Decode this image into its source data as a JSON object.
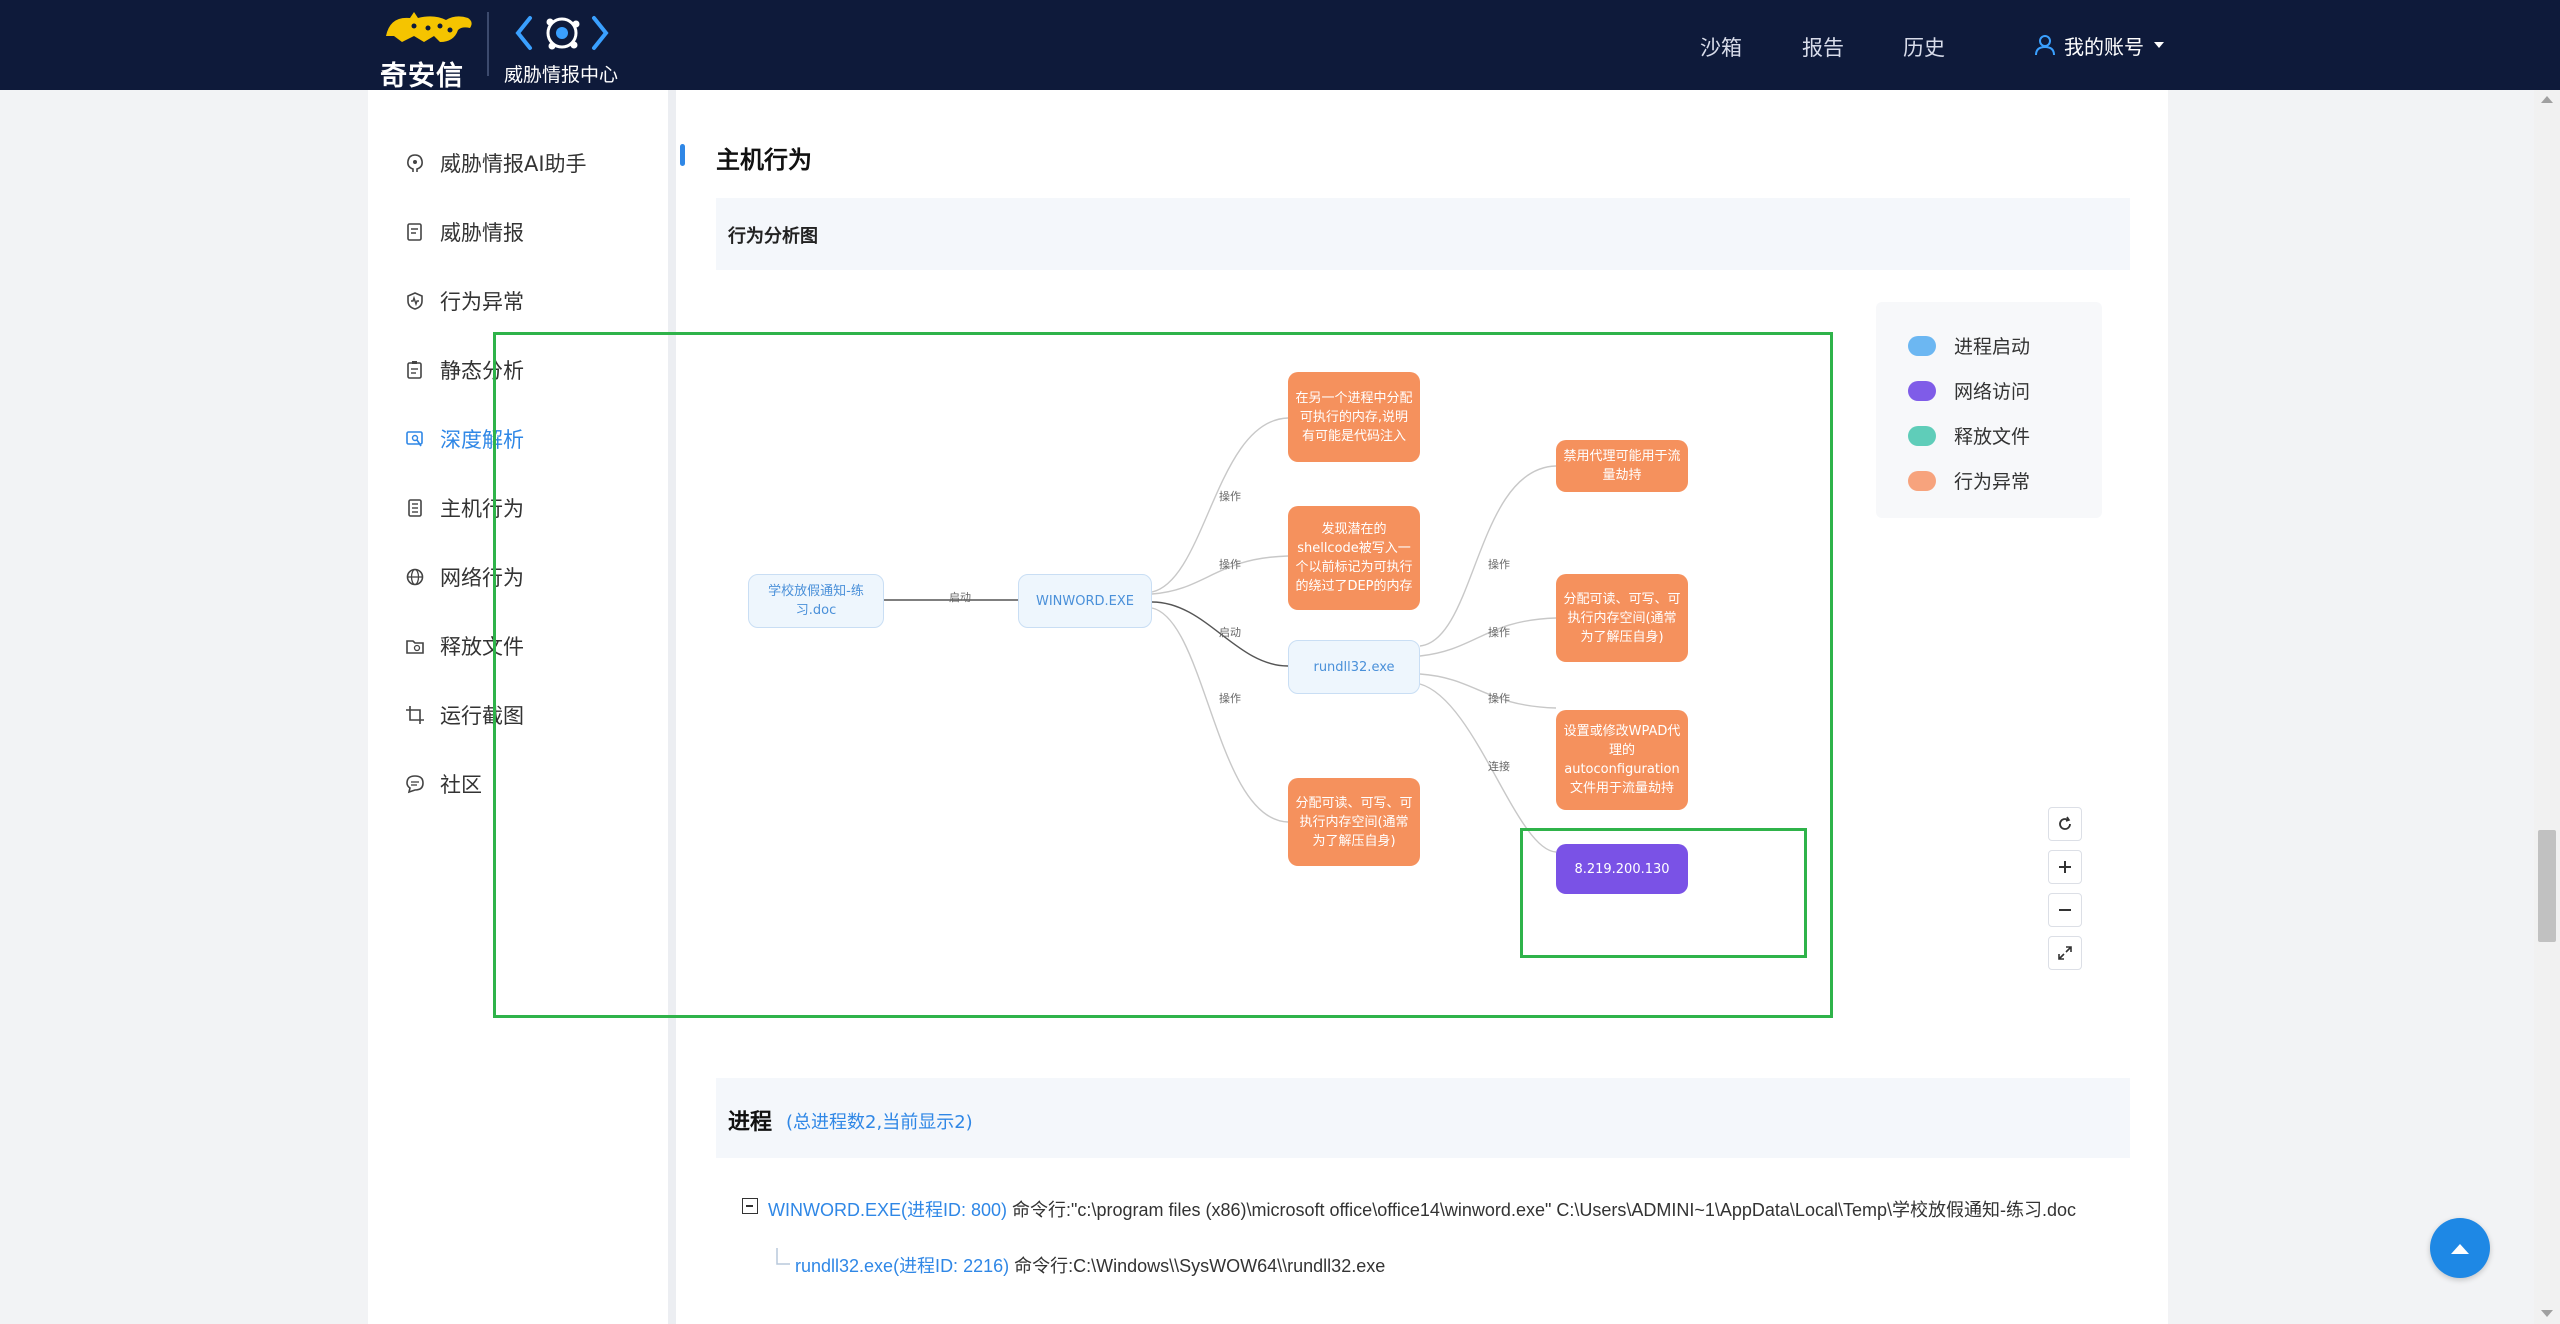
{
  "header": {
    "logo_text": "奇安信",
    "product_name": "威胁情报中心",
    "nav": [
      {
        "label": "沙箱"
      },
      {
        "label": "报告"
      },
      {
        "label": "历史"
      }
    ],
    "account_label": "我的账号"
  },
  "sidebar": {
    "items": [
      {
        "label": "威胁情报AI助手",
        "icon": "ai-brain-icon"
      },
      {
        "label": "威胁情报",
        "icon": "report-icon"
      },
      {
        "label": "行为异常",
        "icon": "shield-pulse-icon"
      },
      {
        "label": "静态分析",
        "icon": "clipboard-icon"
      },
      {
        "label": "深度解析",
        "icon": "deep-analysis-icon",
        "active": true
      },
      {
        "label": "主机行为",
        "icon": "host-icon"
      },
      {
        "label": "网络行为",
        "icon": "network-globe-icon"
      },
      {
        "label": "释放文件",
        "icon": "folder-icon"
      },
      {
        "label": "运行截图",
        "icon": "crop-icon"
      },
      {
        "label": "社区",
        "icon": "chat-icon"
      }
    ]
  },
  "section": {
    "title": "主机行为",
    "subtitle": "行为分析图"
  },
  "graph": {
    "nodes": {
      "doc": "学校放假通知-练习.doc",
      "winword": "WINWORD.EXE",
      "rundll": "rundll32.exe",
      "w1": "在另一个进程中分配可执行的内存,说明有可能是代码注入",
      "w2": "发现潜在的shellcode被写入一个以前标记为可执行的绕过了DEP的内存",
      "w3": "分配可读、可写、可执行内存空间(通常为了解压自身)",
      "r1": "禁用代理可能用于流量劫持",
      "r2": "分配可读、可写、可执行内存空间(通常为了解压自身)",
      "r3": "设置或修改WPAD代理的autoconfiguration文件用于流量劫持",
      "ip": "8.219.200.130"
    },
    "edge_labels": {
      "start1": "启动",
      "op1": "操作",
      "op2": "操作",
      "start2": "启动",
      "op3": "操作",
      "op4": "操作",
      "op5": "操作",
      "op6": "操作",
      "connect": "连接"
    }
  },
  "legend": [
    {
      "label": "进程启动",
      "color": "#6cb7f2"
    },
    {
      "label": "网络访问",
      "color": "#7f5ce8"
    },
    {
      "label": "释放文件",
      "color": "#5fcdb9"
    },
    {
      "label": "行为异常",
      "color": "#f7a37d"
    }
  ],
  "process": {
    "title": "进程",
    "count_text": "(总进程数2,当前显示2)",
    "rows": [
      {
        "name": "WINWORD.EXE(进程ID: 800)",
        "cmd": "命令行:\"c:\\program files (x86)\\microsoft office\\office14\\winword.exe\" C:\\Users\\ADMINI~1\\AppData\\Local\\Temp\\学校放假通知-练习.doc"
      },
      {
        "name": "rundll32.exe(进程ID: 2216)",
        "cmd": "命令行:C:\\Windows\\\\SysWOW64\\\\rundll32.exe"
      }
    ]
  },
  "colors": {
    "accent": "#2f87e6",
    "header_bg": "#0e1a3a",
    "warn_node": "#f5915d",
    "net_node": "#7a52e6",
    "annotation": "#2fb34a"
  }
}
